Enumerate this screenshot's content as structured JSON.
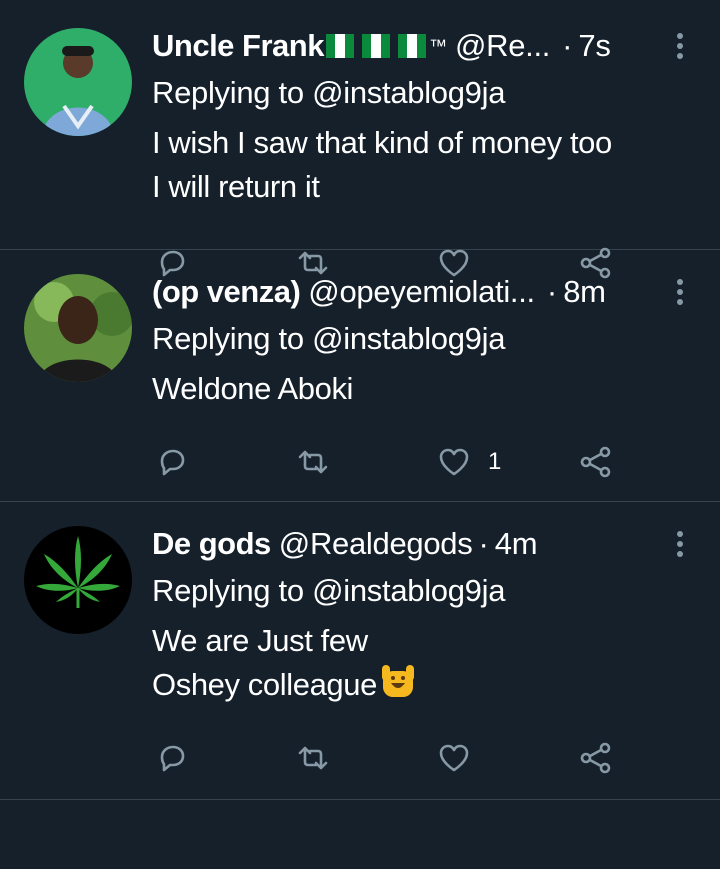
{
  "tweets": [
    {
      "name": "Uncle Frank",
      "name_suffix": "™",
      "flag_icons": [
        "nigeria-flag-icon",
        "nigeria-flag-icon",
        "nigeria-flag-icon"
      ],
      "handle": "@Re...",
      "time": "7s",
      "replying": "Replying to @instablog9ja",
      "lines": [
        "I wish I saw that kind of money too",
        "I will return it"
      ],
      "like_count": ""
    },
    {
      "name": "(op venza)",
      "handle": "@opeyemiolati...",
      "time": "8m",
      "replying": "Replying to @instablog9ja",
      "lines": [
        "Weldone Aboki"
      ],
      "like_count": "1"
    },
    {
      "name": "De gods",
      "handle": "@Realdegods",
      "time": "4m",
      "replying": "Replying to @instablog9ja",
      "lines": [
        "We are Just few",
        "Oshey colleague"
      ],
      "emoji": "raising-hands-emoji",
      "like_count": ""
    }
  ],
  "separator": "·",
  "icons": {
    "more": "more-vertical-icon",
    "reply": "reply-icon",
    "retweet": "retweet-icon",
    "like": "heart-icon",
    "share": "share-icon"
  },
  "colors": {
    "background": "#15202b",
    "divider": "#38444d",
    "icon": "#8899a6",
    "text": "#ffffff"
  }
}
